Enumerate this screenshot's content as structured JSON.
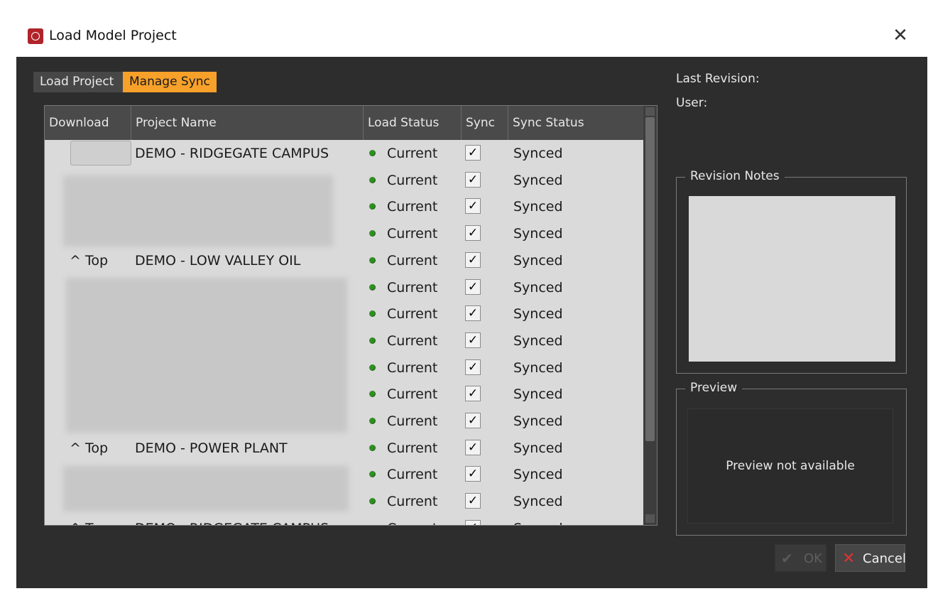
{
  "window": {
    "title": "Load Model Project",
    "close_glyph": "✕",
    "app_icon": "app-logo-icon"
  },
  "tabs": [
    {
      "label": "Load Project",
      "active": false
    },
    {
      "label": "Manage Sync",
      "active": true
    }
  ],
  "columns": [
    "Download",
    "Project Name",
    "Load Status",
    "Sync",
    "Sync Status"
  ],
  "rows": [
    {
      "download": "",
      "download_button": true,
      "name": "DEMO - RIDGEGATE CAMPUS",
      "status": "Current",
      "sync": "✓",
      "sync_status": "Synced"
    },
    {
      "download": "",
      "name": "",
      "status": "Current",
      "sync": "✓",
      "sync_status": "Synced"
    },
    {
      "download": "",
      "name": "",
      "status": "Current",
      "sync": "✓",
      "sync_status": "Synced"
    },
    {
      "download": "",
      "name": "",
      "status": "Current",
      "sync": "✓",
      "sync_status": "Synced"
    },
    {
      "download": "^ Top",
      "name": "DEMO - LOW VALLEY OIL",
      "status": "Current",
      "sync": "✓",
      "sync_status": "Synced"
    },
    {
      "download": "",
      "name": "",
      "status": "Current",
      "sync": "✓",
      "sync_status": "Synced"
    },
    {
      "download": "",
      "name": "",
      "status": "Current",
      "sync": "✓",
      "sync_status": "Synced"
    },
    {
      "download": "",
      "name": "",
      "status": "Current",
      "sync": "✓",
      "sync_status": "Synced"
    },
    {
      "download": "",
      "name": "",
      "status": "Current",
      "sync": "✓",
      "sync_status": "Synced"
    },
    {
      "download": "",
      "name": "",
      "status": "Current",
      "sync": "✓",
      "sync_status": "Synced"
    },
    {
      "download": "",
      "name": "",
      "status": "Current",
      "sync": "✓",
      "sync_status": "Synced"
    },
    {
      "download": "^ Top",
      "name": "DEMO - POWER PLANT",
      "status": "Current",
      "sync": "✓",
      "sync_status": "Synced"
    },
    {
      "download": "",
      "name": "",
      "status": "Current",
      "sync": "✓",
      "sync_status": "Synced"
    },
    {
      "download": "",
      "name": "",
      "status": "Current",
      "sync": "✓",
      "sync_status": "Synced"
    },
    {
      "download": "^ Top",
      "name": "DEMO - RIDGEGATE CAMPUS",
      "status": "Current",
      "sync": "✓",
      "sync_status": "Synced"
    }
  ],
  "status_color": "#2f8f22",
  "accent_color": "#f7a12a",
  "side": {
    "last_revision_label": "Last Revision:",
    "user_label": "User:",
    "revision_notes_title": "Revision Notes",
    "preview_title": "Preview",
    "preview_empty": "Preview not available"
  },
  "buttons": {
    "ok": "OK",
    "ok_icon": "✔",
    "cancel": "Cancel",
    "cancel_icon": "✕"
  }
}
